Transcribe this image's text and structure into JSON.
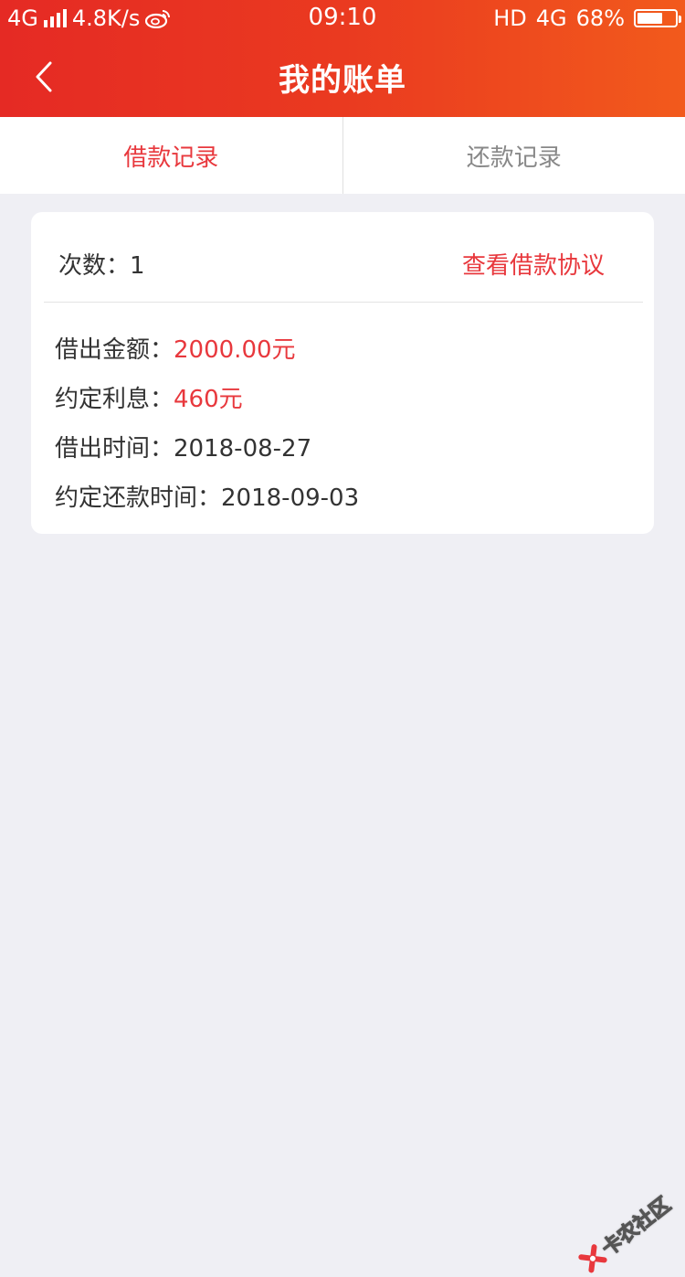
{
  "status_bar": {
    "network_left": "4G",
    "speed": "4.8K/s",
    "time": "09:10",
    "hd": "HD",
    "network_right": "4G",
    "battery_percent": "68%",
    "battery_level": 0.68,
    "icons": [
      "signal-icon",
      "weibo-icon",
      "battery-icon"
    ]
  },
  "header": {
    "back_icon": "chevron-left-icon",
    "title": "我的账单",
    "gradient_colors": [
      "#e52a24",
      "#f25a1c"
    ]
  },
  "tabs": [
    {
      "label": "借款记录",
      "active": true
    },
    {
      "label": "还款记录",
      "active": false
    }
  ],
  "loan_card": {
    "count_label": "次数：",
    "count_value": "1",
    "agreement_link": "查看借款协议",
    "rows": [
      {
        "label": "借出金额：",
        "value": "2000.00元",
        "highlight": true
      },
      {
        "label": "约定利息：",
        "value": "460元",
        "highlight": true
      },
      {
        "label": "借出时间：",
        "value": "2018-08-27",
        "highlight": false
      },
      {
        "label": "约定还款时间：",
        "value": "2018-09-03",
        "highlight": false
      }
    ]
  },
  "watermark": {
    "text": "卡农社区",
    "icon": "kanong-logo-icon"
  },
  "colors": {
    "accent_red": "#e8383d",
    "page_background": "#efeff4"
  }
}
